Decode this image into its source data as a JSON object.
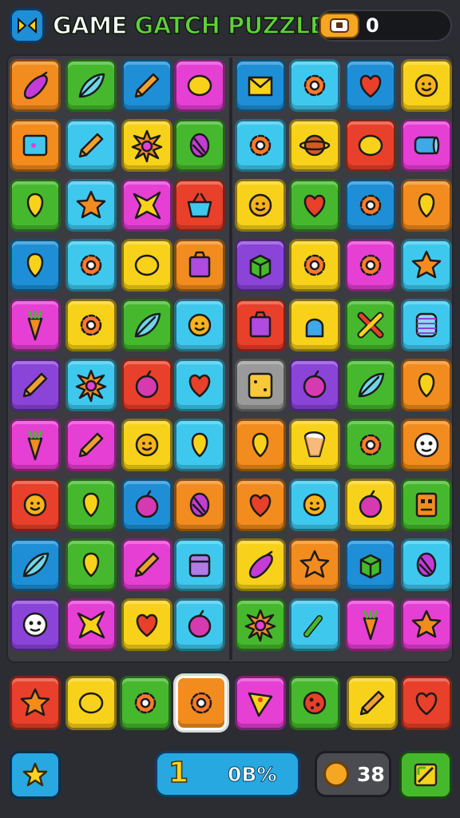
{
  "header": {
    "title_first": "GAME",
    "title_rest": "GATCH PUZZLE",
    "score": "0",
    "logo_icon": "game-logo-icon",
    "score_icon": "coin-chest-icon"
  },
  "board": {
    "columns": 8,
    "rows": 10,
    "tiles": [
      [
        "orange",
        "eggplant"
      ],
      [
        "green",
        "leaf"
      ],
      [
        "blue",
        "pencil"
      ],
      [
        "magenta",
        "lemon"
      ],
      [
        "blue",
        "envelope"
      ],
      [
        "cyan",
        "gear"
      ],
      [
        "blue",
        "heart"
      ],
      [
        "yellow",
        "flower"
      ],
      [
        "orange",
        "screen"
      ],
      [
        "cyan",
        "pencil"
      ],
      [
        "yellow",
        "sun"
      ],
      [
        "green",
        "seed"
      ],
      [
        "cyan",
        "gear"
      ],
      [
        "yellow",
        "planet"
      ],
      [
        "red",
        "lemon"
      ],
      [
        "magenta",
        "bottle"
      ],
      [
        "green",
        "balloon"
      ],
      [
        "cyan",
        "star"
      ],
      [
        "magenta",
        "burst"
      ],
      [
        "red",
        "basket"
      ],
      [
        "yellow",
        "flower"
      ],
      [
        "green",
        "heart"
      ],
      [
        "blue",
        "gear"
      ],
      [
        "orange",
        "balloon"
      ],
      [
        "blue",
        "balloon"
      ],
      [
        "cyan",
        "gear"
      ],
      [
        "yellow",
        "lemon"
      ],
      [
        "orange",
        "box"
      ],
      [
        "purple",
        "cube"
      ],
      [
        "yellow",
        "gear"
      ],
      [
        "magenta",
        "gear"
      ],
      [
        "cyan",
        "star"
      ],
      [
        "magenta",
        "carrot"
      ],
      [
        "yellow",
        "gear"
      ],
      [
        "green",
        "leaf"
      ],
      [
        "cyan",
        "flower"
      ],
      [
        "red",
        "box"
      ],
      [
        "yellow",
        "pot"
      ],
      [
        "green",
        "cross"
      ],
      [
        "cyan",
        "coil"
      ],
      [
        "purple",
        "pencil"
      ],
      [
        "cyan",
        "sun"
      ],
      [
        "red",
        "apple"
      ],
      [
        "cyan",
        "heart"
      ],
      [
        "gray",
        "toaster"
      ],
      [
        "purple",
        "apple"
      ],
      [
        "green",
        "leaf"
      ],
      [
        "orange",
        "balloon"
      ],
      [
        "magenta",
        "carrot"
      ],
      [
        "magenta",
        "pencil"
      ],
      [
        "yellow",
        "flower"
      ],
      [
        "cyan",
        "balloon"
      ],
      [
        "orange",
        "balloon"
      ],
      [
        "yellow",
        "tooth"
      ],
      [
        "green",
        "gear"
      ],
      [
        "orange",
        "face"
      ],
      [
        "red",
        "flower"
      ],
      [
        "green",
        "balloon"
      ],
      [
        "blue",
        "apple"
      ],
      [
        "orange",
        "seed"
      ],
      [
        "orange",
        "heart"
      ],
      [
        "cyan",
        "flower"
      ],
      [
        "yellow",
        "apple"
      ],
      [
        "green",
        "robot"
      ],
      [
        "blue",
        "leaf"
      ],
      [
        "green",
        "balloon"
      ],
      [
        "magenta",
        "pencil"
      ],
      [
        "cyan",
        "jar"
      ],
      [
        "yellow",
        "eggplant"
      ],
      [
        "orange",
        "star"
      ],
      [
        "blue",
        "cube"
      ],
      [
        "cyan",
        "seed"
      ],
      [
        "purple",
        "face"
      ],
      [
        "magenta",
        "burst"
      ],
      [
        "yellow",
        "heart"
      ],
      [
        "cyan",
        "apple"
      ],
      [
        "green",
        "sun"
      ],
      [
        "cyan",
        "hammer"
      ],
      [
        "magenta",
        "carrot"
      ],
      [
        "magenta",
        "star"
      ]
    ]
  },
  "tray": {
    "tiles": [
      [
        "red",
        "star"
      ],
      [
        "yellow",
        "lemon"
      ],
      [
        "green",
        "gear"
      ],
      [
        "orange",
        "gear"
      ],
      [
        "magenta",
        "pizza"
      ],
      [
        "green",
        "ladybug"
      ],
      [
        "yellow",
        "pencil"
      ],
      [
        "red",
        "heart"
      ]
    ],
    "selected_index": 3
  },
  "footer": {
    "level": "1",
    "progress": "0B%",
    "timer": "38",
    "left_button_icon": "star-icon",
    "right_button_icon": "shuffle-icon"
  },
  "colors": {
    "orange": "#f28c1e",
    "green": "#46b82e",
    "blue": "#1e8fd6",
    "magenta": "#e63fd4",
    "cyan": "#3fc8ee",
    "yellow": "#f8d21a",
    "red": "#e8402a",
    "purple": "#8a44d8",
    "gray": "#9a9a9a"
  }
}
